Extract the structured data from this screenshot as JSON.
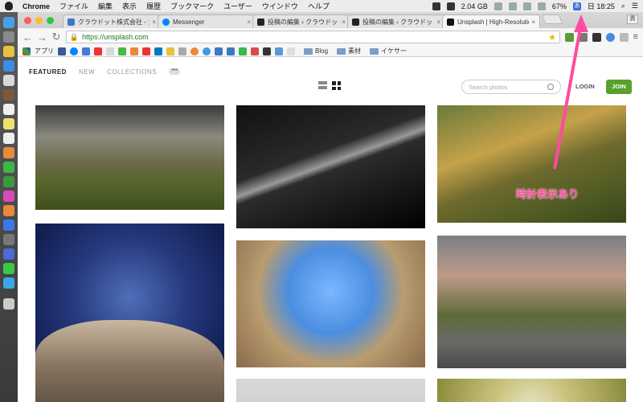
{
  "menubar": {
    "app": "Chrome",
    "items": [
      "ファイル",
      "編集",
      "表示",
      "履歴",
      "ブックマーク",
      "ユーザー",
      "ウインドウ",
      "ヘルプ"
    ],
    "memory": "2.04 GB",
    "battery": "67%",
    "input_method": "あ",
    "clock": "日 18:25"
  },
  "tabs": [
    {
      "label": "クラウドット株式会社 - カ",
      "color": "#3a78c8"
    },
    {
      "label": "Messenger",
      "color": "#0084ff"
    },
    {
      "label": "投稿の編集 ‹ クラウドット株",
      "color": "#222222"
    },
    {
      "label": "投稿の編集 ‹ クラウドット株",
      "color": "#222222"
    },
    {
      "label": "Unsplash | High-Resolutio",
      "color": "#111111"
    }
  ],
  "toolbar": {
    "url": "https://unsplash.com",
    "user_button": "異"
  },
  "bookmarks": {
    "apps_label": "アプリ",
    "folders": [
      "Blog",
      "素材",
      "イケサー"
    ]
  },
  "site": {
    "nav": [
      "FEATURED",
      "NEW",
      "COLLECTIONS"
    ],
    "more": "•••",
    "search_placeholder": "Search photos",
    "login": "LOGIN",
    "join": "JOIN"
  },
  "annotation": "時計表示あり",
  "colors": {
    "join_green": "#5aa02c",
    "annotation_pink": "#ff4ba0"
  }
}
